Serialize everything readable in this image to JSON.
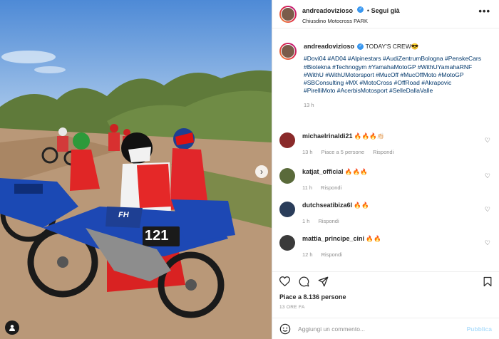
{
  "post": {
    "username": "andreadovizioso",
    "follow_label": "Segui già",
    "location": "Chiusdino Motocross PARK",
    "more_label": "•••"
  },
  "caption": {
    "username": "andreadovizioso",
    "text": "TODAY'S CREW😎",
    "hashtags": "#Dovi04 #AD04 #Alpinestars #AudiZentrumBologna #PenskeCars #Biotekna #Technogym #YamahaMotoGP #WithUYamahaRNF #WithU #WithUMotorsport #MucOff #MucOffMoto #MotoGP #SBConsulting #MX #MotoCross #OffRoad #Akrapovic #PirelliMoto #AcerbisMotosport #SelleDallaValle",
    "time": "13 h"
  },
  "comments": [
    {
      "username": "michaelrinaldi21",
      "text": "🔥🔥🔥👏🏻",
      "time": "13 h",
      "likes": "Piace a 5 persone",
      "reply": "Rispondi",
      "avatar_color": "#8a2a2a"
    },
    {
      "username": "katjat_official",
      "text": "🔥🔥🔥",
      "time": "11 h",
      "likes": "",
      "reply": "Rispondi",
      "avatar_color": "#5a6a3a"
    },
    {
      "username": "dutchseatibiza6l",
      "text": "🔥🔥",
      "time": "1 h",
      "likes": "",
      "reply": "Rispondi",
      "avatar_color": "#2a3d5a"
    },
    {
      "username": "mattia_principe_cini",
      "text": "🔥🔥",
      "time": "12 h",
      "likes": "",
      "reply": "Rispondi",
      "avatar_color": "#3a3a3a"
    }
  ],
  "actions": {
    "likes_text": "Piace a 8.136 persone",
    "posted_ago": "13 ORE FA"
  },
  "add_comment": {
    "placeholder": "Aggiungi un commento...",
    "publish_label": "Pubblica"
  },
  "photo": {
    "plate_number": "121",
    "plate_brand": "FH"
  }
}
